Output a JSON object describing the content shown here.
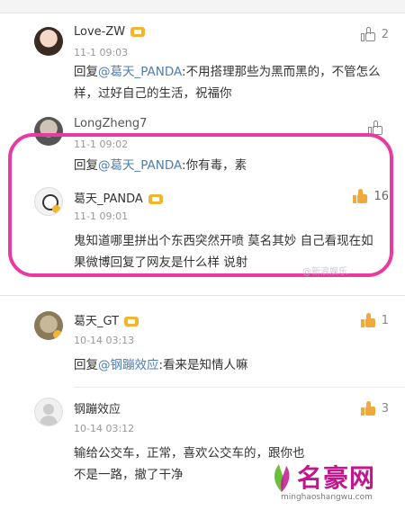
{
  "comments": [
    {
      "name": "Love-ZW",
      "time": "11-1 09:03",
      "likes": "2",
      "liked": false,
      "reply_prefix": "回复",
      "mention": "@葛天_PANDA",
      "text": ":不用搭理那些为黑而黑的，不管怎么样，过好自己的生活，祝福你"
    },
    {
      "name": "LongZheng7",
      "time": "11-1 09:02",
      "likes": "",
      "liked": false,
      "reply_prefix": "回复",
      "mention": "@葛天_PANDA",
      "text": ":你有毒，素"
    },
    {
      "name": "葛天_PANDA",
      "time": "11-1 09:01",
      "likes": "16",
      "liked": true,
      "text": "鬼知道哪里拼出个东西突然开喷 莫名其妙 自己看现在如果微博回复了网友是什么样 说射"
    },
    {
      "name": "葛天_GT",
      "time": "10-14 03:13",
      "likes": "1",
      "liked": true,
      "reply_prefix": "回复",
      "mention": "@钢蹦效应",
      "text": ":看来是知情人嘛"
    },
    {
      "name": "钢蹦效应",
      "time": "10-14 03:12",
      "likes": "3",
      "liked": true,
      "text": "输给公交车，正常，喜欢公交车的，跟你也不是一路，撤了干净"
    }
  ],
  "watermark": {
    "small": "@新浪娱乐",
    "title": "名豪网",
    "url": "minghaoshangwu.com"
  },
  "colors": {
    "highlight": "#e93aa0",
    "mention": "#507daf",
    "like_active": "#f0a93c"
  }
}
